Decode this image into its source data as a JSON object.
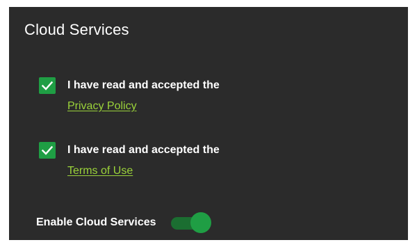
{
  "panel": {
    "title": "Cloud Services"
  },
  "consents": [
    {
      "checked": true,
      "text": "I have read and accepted the",
      "link_label": "Privacy Policy"
    },
    {
      "checked": true,
      "text": "I have read and accepted the",
      "link_label": "Terms of Use"
    }
  ],
  "cloud_toggle": {
    "label": "Enable Cloud Services",
    "enabled": true
  },
  "colors": {
    "panel_background": "#2b2b2b",
    "accent_green": "#1f9e44",
    "link_green": "#9bd33a",
    "toggle_track": "#1b6e31",
    "text": "#ffffff"
  },
  "icons": {
    "checkbox": "checkmark-icon"
  }
}
